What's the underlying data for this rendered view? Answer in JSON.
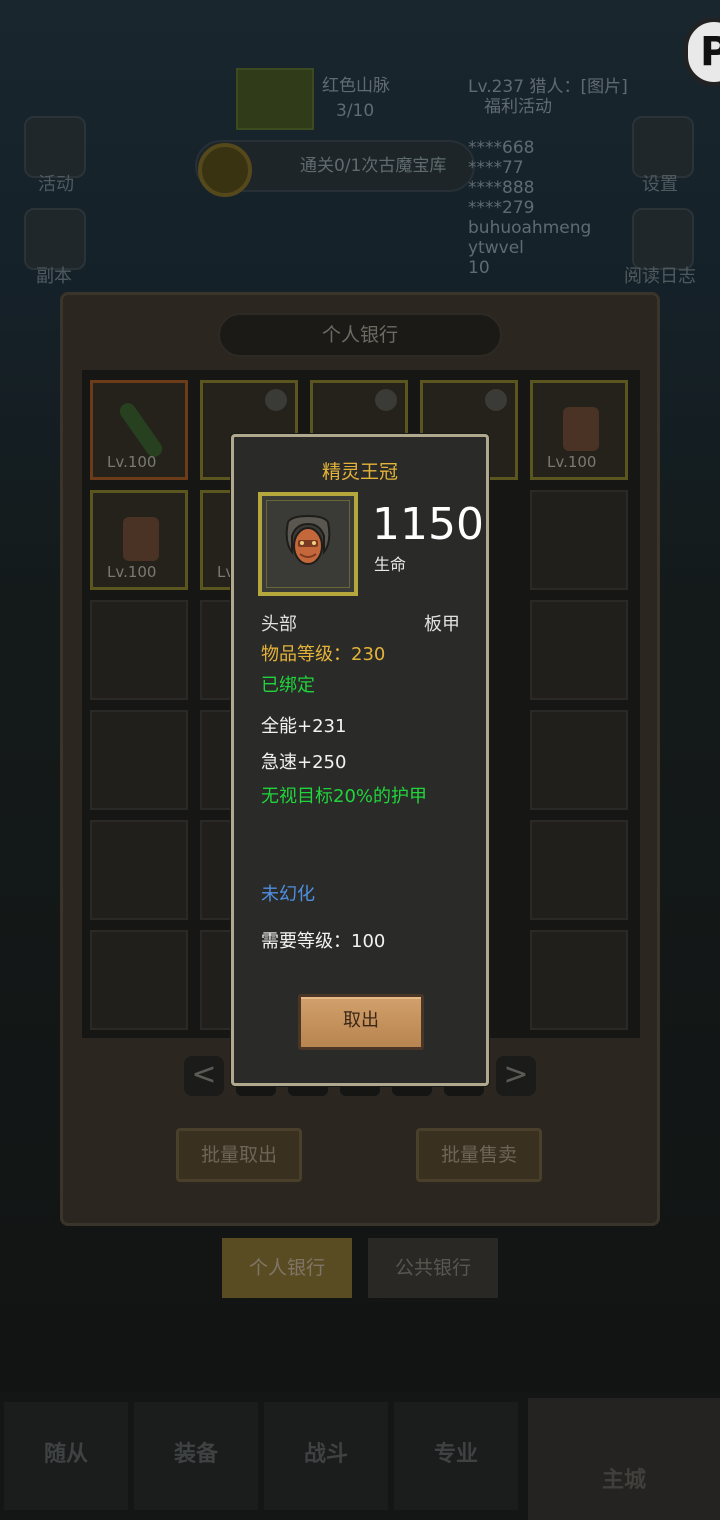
{
  "hud": {
    "zone_name": "红色山脉",
    "zone_progress": "3/10",
    "player_info": "Lv.237 猎人：[图片]",
    "welfare": "福利活动",
    "quest": "通关0/1次古魔宝库",
    "chat_lines": [
      "****668",
      "****77",
      "****888",
      "****279",
      "buhuoahmeng",
      "ytwvel",
      "10"
    ],
    "left_icons": [
      "活动",
      "副本"
    ],
    "right_icons": [
      "设置",
      "阅读日志"
    ],
    "badge": "P"
  },
  "bank": {
    "title": "个人银行",
    "slots": [
      {
        "lv": "Lv.100"
      },
      {
        "lv": ""
      },
      {
        "lv": ""
      },
      {
        "lv": ""
      },
      {
        "lv": "Lv.100"
      },
      {
        "lv": "Lv.100"
      },
      {
        "lv": "Lv."
      }
    ],
    "prev": "<",
    "next": ">",
    "batch_take": "批量取出",
    "batch_sell": "批量售卖",
    "tab_personal": "个人银行",
    "tab_public": "公共银行"
  },
  "nav": {
    "items": [
      "随从",
      "装备",
      "战斗",
      "专业"
    ],
    "home": "主城"
  },
  "tooltip": {
    "name": "精灵王冠",
    "value": "1150",
    "value_label": "生命",
    "slot": "头部",
    "armor": "板甲",
    "item_level": "物品等级：230",
    "bound": "已绑定",
    "stat1": "全能+231",
    "stat2": "急速+250",
    "effect": "无视目标20%的护甲",
    "transmog": "未幻化",
    "require": "需要等级：100",
    "take_out": "取出"
  },
  "colors": {
    "gold": "#e4b33a",
    "green": "#21d33c",
    "blue": "#4f8fe0",
    "button": "#c8965f"
  }
}
